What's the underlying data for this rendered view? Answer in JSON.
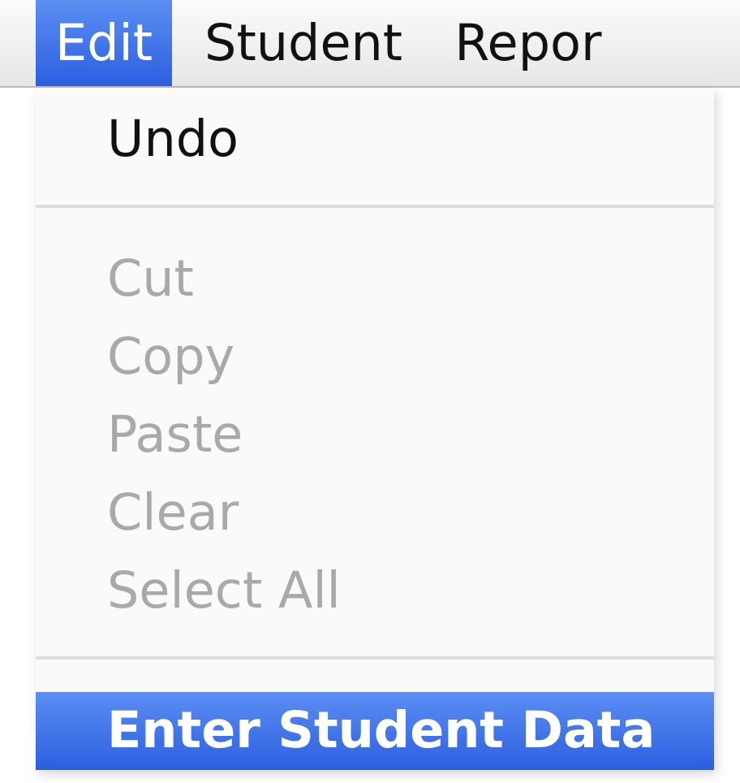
{
  "menu_bar": {
    "items": [
      {
        "label": "Edit",
        "selected": true
      },
      {
        "label": "Student",
        "selected": false
      },
      {
        "label": "Repor",
        "selected": false
      }
    ]
  },
  "menu": {
    "items": [
      {
        "kind": "item",
        "label": "Undo",
        "disabled": false,
        "selected": false
      },
      {
        "kind": "separator"
      },
      {
        "kind": "item",
        "label": "Cut",
        "disabled": true,
        "selected": false
      },
      {
        "kind": "item",
        "label": "Copy",
        "disabled": true,
        "selected": false
      },
      {
        "kind": "item",
        "label": "Paste",
        "disabled": true,
        "selected": false
      },
      {
        "kind": "item",
        "label": "Clear",
        "disabled": true,
        "selected": false
      },
      {
        "kind": "item",
        "label": "Select All",
        "disabled": true,
        "selected": false
      },
      {
        "kind": "separator"
      },
      {
        "kind": "item",
        "label": "Enter Student Data",
        "disabled": false,
        "selected": true
      }
    ]
  }
}
